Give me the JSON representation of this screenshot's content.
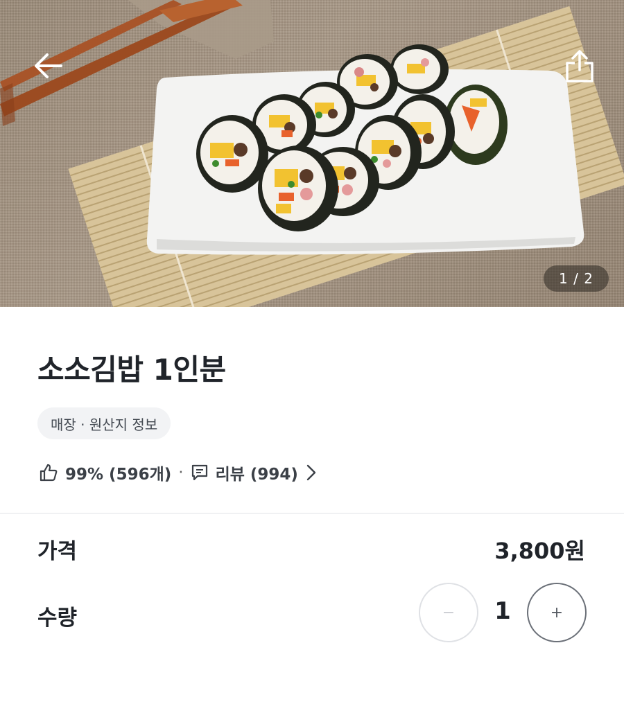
{
  "hero": {
    "page_indicator": "1 / 2",
    "back_icon": "back-arrow-icon",
    "share_icon": "share-icon"
  },
  "product": {
    "title": "소소김밥 1인분",
    "origin_chip": "매장 · 원산지 정보"
  },
  "rating": {
    "like_icon": "thumbs-up-icon",
    "like_text": "99% (596개)",
    "separator": "·",
    "review_icon": "comment-icon",
    "review_text": "리뷰 (994)",
    "chevron_icon": "chevron-right-icon"
  },
  "price": {
    "label": "가격",
    "value": "3,800원"
  },
  "quantity": {
    "label": "수량",
    "value": "1",
    "minus": "−",
    "plus": "+"
  },
  "colors": {
    "text": "#1f2329",
    "chip_bg": "#f2f3f5",
    "divider": "#f0f1f3",
    "disabled_border": "#dfe1e5",
    "active_border": "#6b7078"
  }
}
